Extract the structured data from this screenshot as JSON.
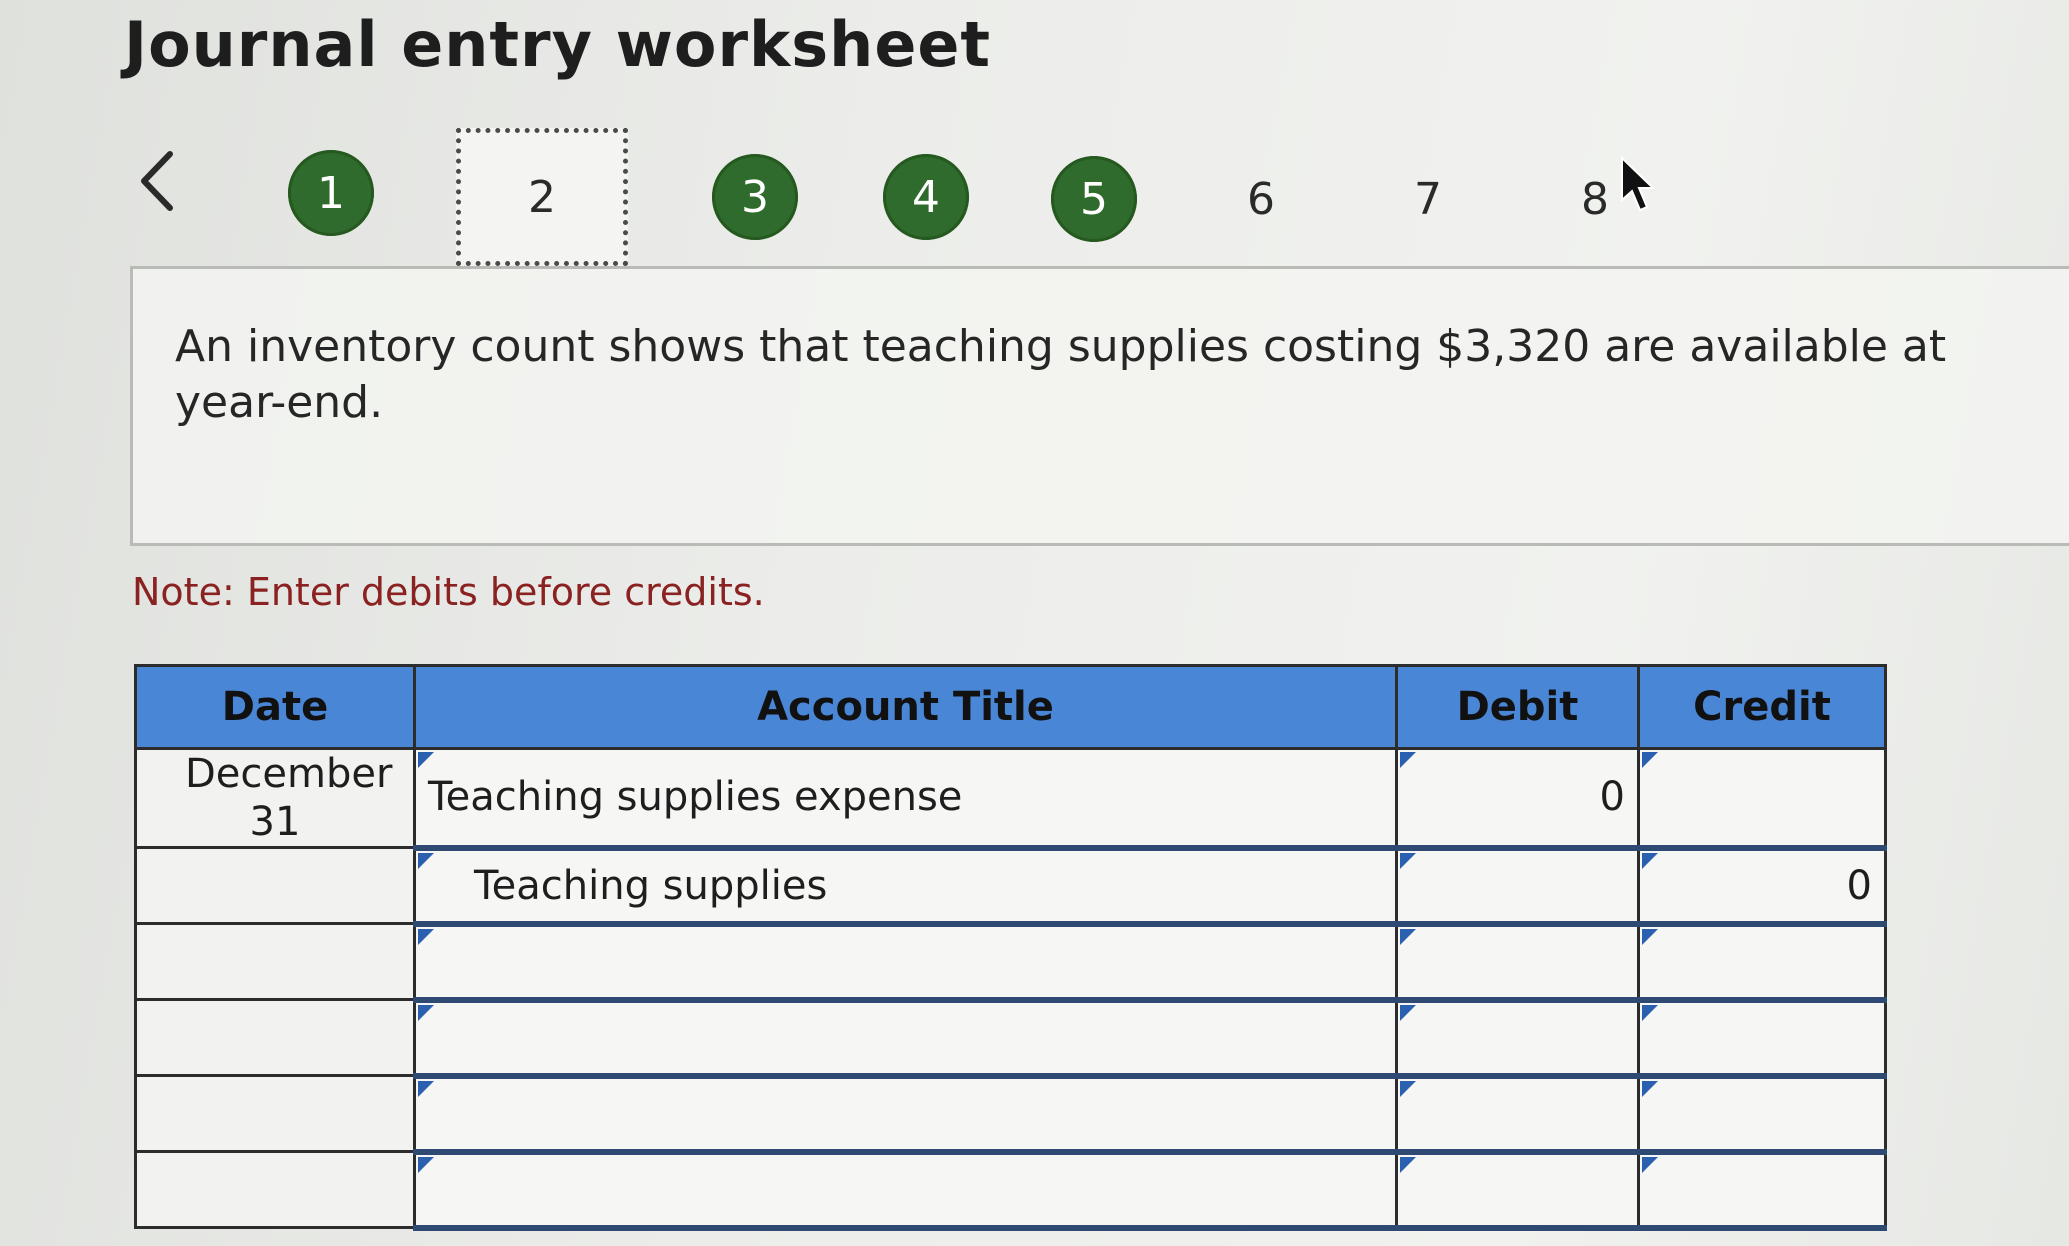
{
  "header": {
    "title": "Journal entry worksheet"
  },
  "stepper": {
    "prev_icon": "chevron-left-icon",
    "steps": [
      {
        "label": "1",
        "state": "completed"
      },
      {
        "label": "2",
        "state": "current"
      },
      {
        "label": "3",
        "state": "completed"
      },
      {
        "label": "4",
        "state": "completed"
      },
      {
        "label": "5",
        "state": "completed"
      },
      {
        "label": "6",
        "state": "not-started"
      },
      {
        "label": "7",
        "state": "not-started"
      },
      {
        "label": "8",
        "state": "not-started"
      }
    ]
  },
  "question": {
    "text": "An inventory count shows that teaching supplies costing $3,320 are available at year-end."
  },
  "note": "Note: Enter debits before credits.",
  "journal": {
    "headers": [
      "Date",
      "Account Title",
      "Debit",
      "Credit"
    ],
    "rows": [
      {
        "date": "December 31",
        "account": "Teaching supplies expense",
        "debit": "0",
        "credit": ""
      },
      {
        "date": "",
        "account": "Teaching supplies",
        "debit": "",
        "credit": "0"
      },
      {
        "date": "",
        "account": "",
        "debit": "",
        "credit": ""
      },
      {
        "date": "",
        "account": "",
        "debit": "",
        "credit": ""
      },
      {
        "date": "",
        "account": "",
        "debit": "",
        "credit": ""
      },
      {
        "date": "",
        "account": "",
        "debit": "",
        "credit": ""
      }
    ]
  },
  "colors": {
    "completed_step": "#2f6b2c",
    "table_header": "#4a86d6",
    "note_text": "#8a2222"
  }
}
